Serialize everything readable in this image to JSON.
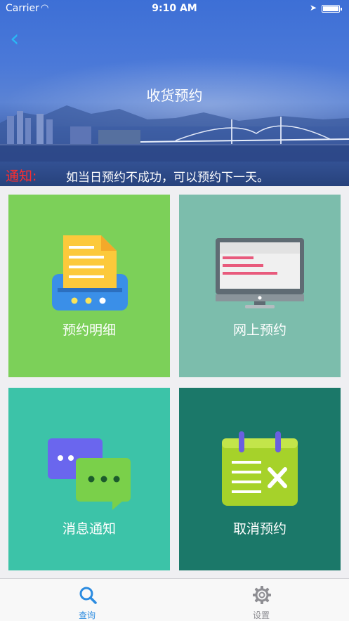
{
  "status_bar": {
    "carrier": "Carrier",
    "time": "9:10 AM"
  },
  "header": {
    "title": "收货预约"
  },
  "notice": {
    "label": "通知:",
    "text": "如当日预约不成功，可以预约下一天。"
  },
  "tiles": [
    {
      "label": "预约明细",
      "color": "#7cd059"
    },
    {
      "label": "网上预约",
      "color": "#7cbdac"
    },
    {
      "label": "消息通知",
      "color": "#3cc3a8"
    },
    {
      "label": "取消预约",
      "color": "#1b7869"
    }
  ],
  "tabbar": [
    {
      "label": "查询",
      "active": true,
      "icon": "search-icon"
    },
    {
      "label": "设置",
      "active": false,
      "icon": "gear-icon"
    }
  ]
}
